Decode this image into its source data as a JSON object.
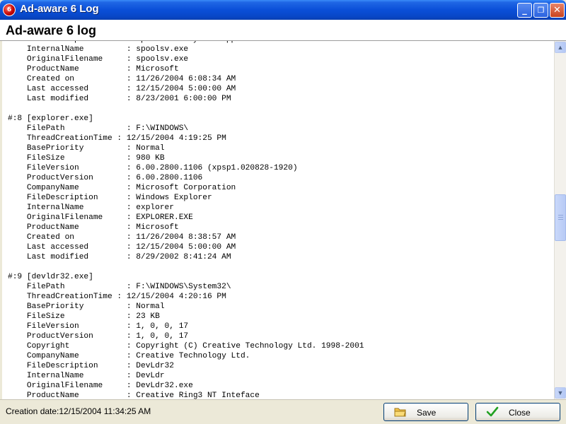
{
  "window": {
    "title": "Ad-aware 6 Log",
    "icon_label": "6"
  },
  "header": {
    "title": "Ad-aware 6 log"
  },
  "log": {
    "lines": [
      "    FileDescription      : Spooler SubSystem App",
      "    InternalName         : spoolsv.exe",
      "    OriginalFilename     : spoolsv.exe",
      "    ProductName          : Microsoft",
      "    Created on           : 11/26/2004 6:08:34 AM",
      "    Last accessed        : 12/15/2004 5:00:00 AM",
      "    Last modified        : 8/23/2001 6:00:00 PM",
      "",
      "#:8 [explorer.exe]",
      "    FilePath             : F:\\WINDOWS\\",
      "    ThreadCreationTime : 12/15/2004 4:19:25 PM",
      "    BasePriority         : Normal",
      "    FileSize             : 980 KB",
      "    FileVersion          : 6.00.2800.1106 (xpsp1.020828-1920)",
      "    ProductVersion       : 6.00.2800.1106",
      "    CompanyName          : Microsoft Corporation",
      "    FileDescription      : Windows Explorer",
      "    InternalName         : explorer",
      "    OriginalFilename     : EXPLORER.EXE",
      "    ProductName          : Microsoft",
      "    Created on           : 11/26/2004 8:38:57 AM",
      "    Last accessed        : 12/15/2004 5:00:00 AM",
      "    Last modified        : 8/29/2002 8:41:24 AM",
      "",
      "#:9 [devldr32.exe]",
      "    FilePath             : F:\\WINDOWS\\System32\\",
      "    ThreadCreationTime : 12/15/2004 4:20:16 PM",
      "    BasePriority         : Normal",
      "    FileSize             : 23 KB",
      "    FileVersion          : 1, 0, 0, 17",
      "    ProductVersion       : 1, 0, 0, 17",
      "    Copyright            : Copyright (C) Creative Technology Ltd. 1998-2001",
      "    CompanyName          : Creative Technology Ltd.",
      "    FileDescription      : DevLdr32",
      "    InternalName         : DevLdr",
      "    OriginalFilename     : DevLdr32.exe",
      "    ProductName          : Creative Ring3 NT Inteface"
    ]
  },
  "status": {
    "creation_date": "Creation date:12/15/2004 11:34:25 AM"
  },
  "buttons": {
    "save_label": "Save",
    "close_label": "Close"
  },
  "icons": {
    "app": "adaware-icon",
    "minimize": "minimize-icon",
    "maximize": "restore-icon",
    "close": "close-icon",
    "scroll_up": "arrow-up-icon",
    "scroll_down": "arrow-down-icon",
    "save": "folder-icon",
    "close_button": "checkmark-icon"
  },
  "colors": {
    "titlebar": "#0A4FD8",
    "background": "#ECE9D8",
    "checkmark": "#21A121"
  }
}
